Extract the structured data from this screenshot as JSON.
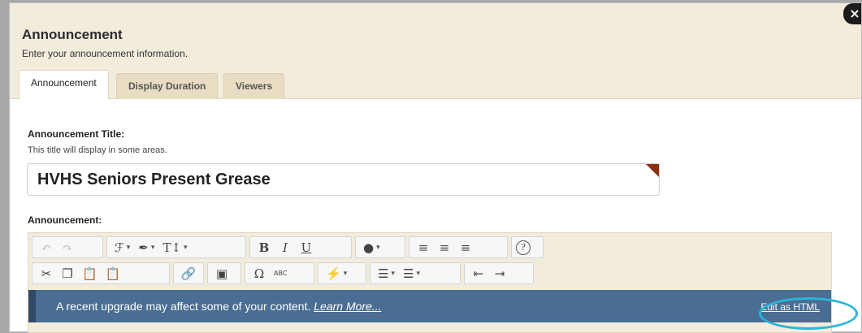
{
  "dialog": {
    "title": "Announcement",
    "subtitle": "Enter your announcement information.",
    "close_icon": "×"
  },
  "tabs": [
    {
      "label": "Announcement"
    },
    {
      "label": "Display Duration"
    },
    {
      "label": "Viewers"
    }
  ],
  "title_field": {
    "label": "Announcement Title:",
    "help": "This title will display in some areas.",
    "value": "HVHS Seniors Present Grease"
  },
  "announcement_field": {
    "label": "Announcement:"
  },
  "toolbar": {
    "undo": "↶",
    "redo": "↷",
    "font": "ℱ",
    "style": "✒",
    "size": "T↕",
    "bold": "B",
    "italic": "I",
    "underline": "U",
    "color": "●",
    "align_left": "≡",
    "align_center": "≡",
    "align_right": "≡",
    "help": "?",
    "cut": "✂",
    "copy": "❐",
    "paste": "📋",
    "paste_text": "📋",
    "link": "🔗",
    "image": "▣",
    "special_char": "Ω",
    "spellcheck": "ABC",
    "flash": "⚡",
    "bullet_list": "☰",
    "number_list": "☰",
    "outdent": "⇤",
    "indent": "⇥",
    "caret": "▾"
  },
  "notice": {
    "text": "A recent upgrade may affect some of your content.",
    "link": "Learn More...",
    "edit_html": "Edit as HTML"
  },
  "colors": {
    "header_bg": "#f2ecdd",
    "notice_bg": "#4a6e93",
    "highlight": "#2bb5da",
    "title_flag": "#8b2e12"
  }
}
